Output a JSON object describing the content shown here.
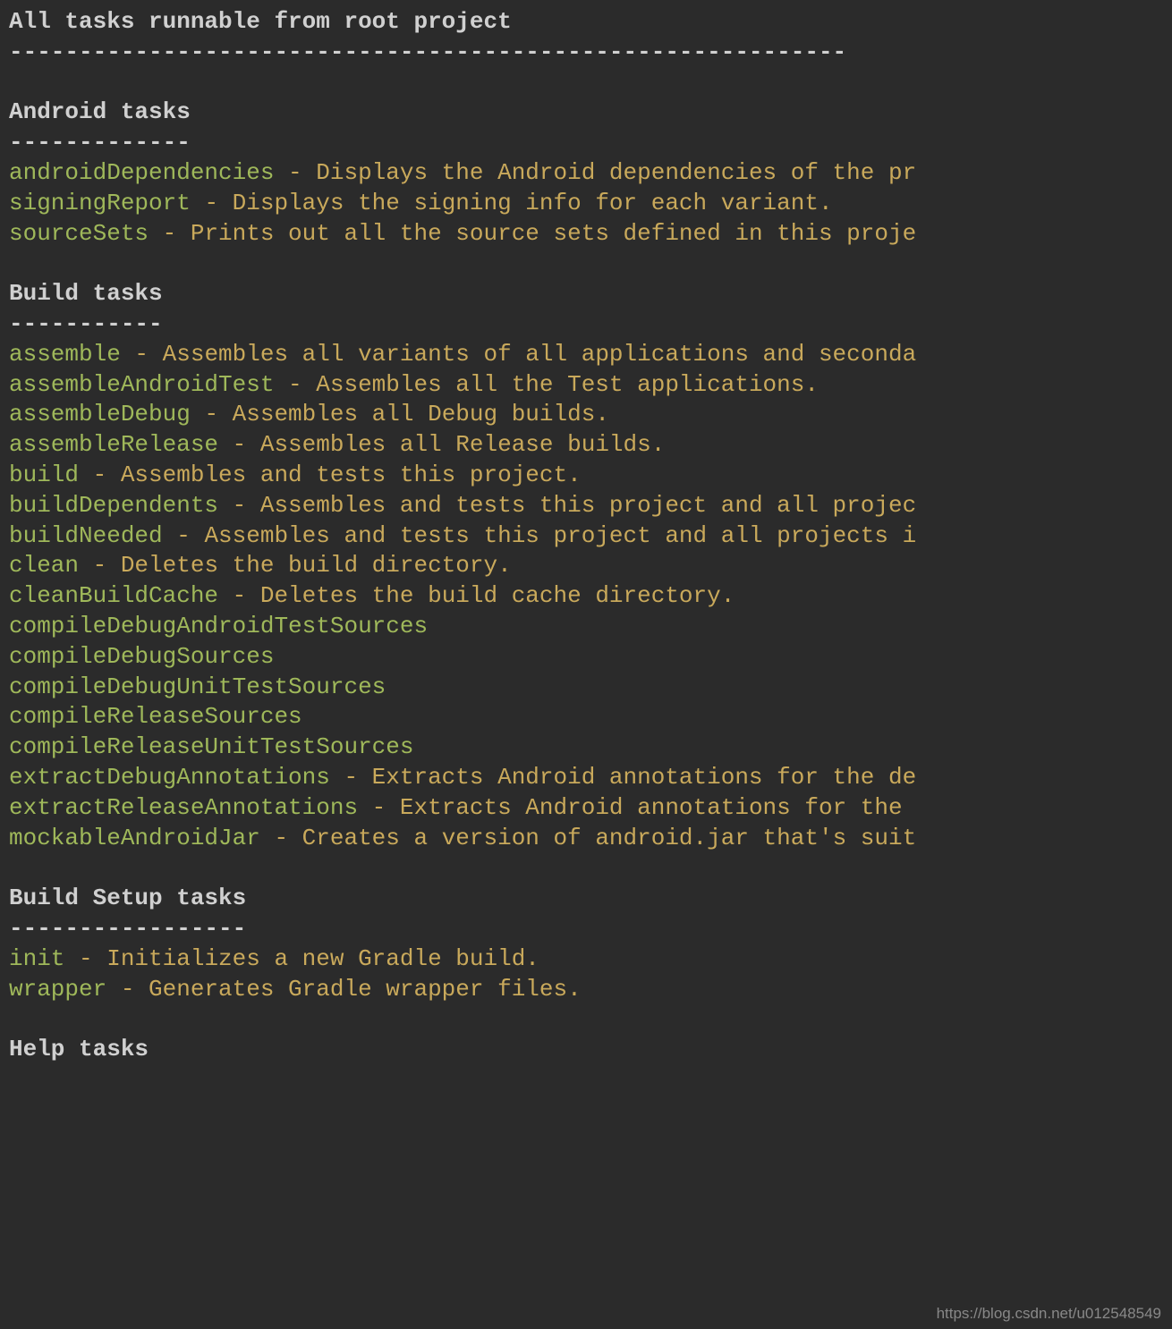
{
  "header": {
    "title": "All tasks runnable from root project",
    "divider": "------------------------------------------------------------"
  },
  "sections": [
    {
      "title": "Android tasks",
      "divider": "-------------",
      "tasks": [
        {
          "name": "androidDependencies",
          "sep": " - ",
          "desc": "Displays the Android dependencies of the pr"
        },
        {
          "name": "signingReport",
          "sep": " - ",
          "desc": "Displays the signing info for each variant."
        },
        {
          "name": "sourceSets",
          "sep": " - ",
          "desc": "Prints out all the source sets defined in this proje"
        }
      ]
    },
    {
      "title": "Build tasks",
      "divider": "-----------",
      "tasks": [
        {
          "name": "assemble",
          "sep": " - ",
          "desc": "Assembles all variants of all applications and seconda"
        },
        {
          "name": "assembleAndroidTest",
          "sep": " - ",
          "desc": "Assembles all the Test applications."
        },
        {
          "name": "assembleDebug",
          "sep": " - ",
          "desc": "Assembles all Debug builds."
        },
        {
          "name": "assembleRelease",
          "sep": " - ",
          "desc": "Assembles all Release builds."
        },
        {
          "name": "build",
          "sep": " - ",
          "desc": "Assembles and tests this project."
        },
        {
          "name": "buildDependents",
          "sep": " - ",
          "desc": "Assembles and tests this project and all projec"
        },
        {
          "name": "buildNeeded",
          "sep": " - ",
          "desc": "Assembles and tests this project and all projects i"
        },
        {
          "name": "clean",
          "sep": " - ",
          "desc": "Deletes the build directory."
        },
        {
          "name": "cleanBuildCache",
          "sep": " - ",
          "desc": "Deletes the build cache directory."
        },
        {
          "name": "compileDebugAndroidTestSources",
          "sep": "",
          "desc": ""
        },
        {
          "name": "compileDebugSources",
          "sep": "",
          "desc": ""
        },
        {
          "name": "compileDebugUnitTestSources",
          "sep": "",
          "desc": ""
        },
        {
          "name": "compileReleaseSources",
          "sep": "",
          "desc": ""
        },
        {
          "name": "compileReleaseUnitTestSources",
          "sep": "",
          "desc": ""
        },
        {
          "name": "extractDebugAnnotations",
          "sep": " - ",
          "desc": "Extracts Android annotations for the de"
        },
        {
          "name": "extractReleaseAnnotations",
          "sep": " - ",
          "desc": "Extracts Android annotations for the "
        },
        {
          "name": "mockableAndroidJar",
          "sep": " - ",
          "desc": "Creates a version of android.jar that's suit"
        }
      ]
    },
    {
      "title": "Build Setup tasks",
      "divider": "-----------------",
      "tasks": [
        {
          "name": "init",
          "sep": " - ",
          "desc": "Initializes a new Gradle build."
        },
        {
          "name": "wrapper",
          "sep": " - ",
          "desc": "Generates Gradle wrapper files."
        }
      ]
    },
    {
      "title": "Help tasks",
      "divider": "",
      "tasks": []
    }
  ],
  "watermark": "https://blog.csdn.net/u012548549"
}
